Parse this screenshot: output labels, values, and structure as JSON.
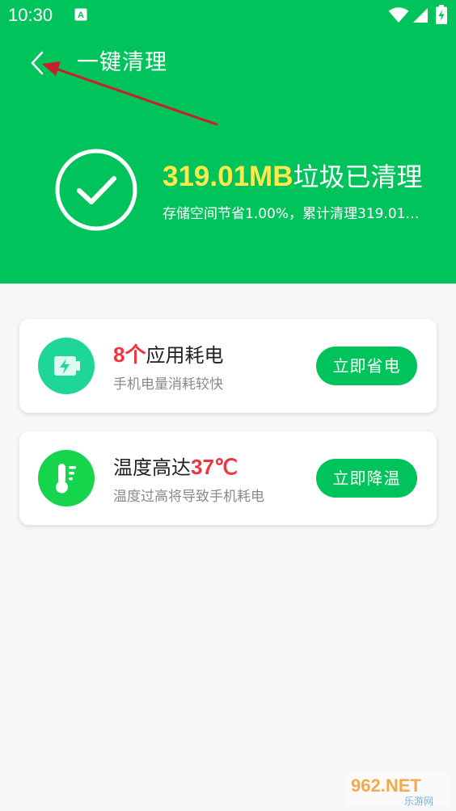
{
  "status_bar": {
    "time": "10:30",
    "notification_icon": "a-notification-icon",
    "wifi_icon": "wifi-icon",
    "signal_icon": "signal-icon",
    "battery_icon": "battery-charging-icon"
  },
  "header": {
    "title": "一键清理",
    "back_icon": "chevron-left-icon",
    "background_color": "#00c45b"
  },
  "clean_result": {
    "amount": "319.01MB",
    "status": "垃圾已清理",
    "subtitle": "存储空间节省1.00%，累计清理319.01…",
    "amount_color": "#ffe84a"
  },
  "cards": [
    {
      "icon": "battery-bolt-icon",
      "highlight": "8个",
      "title": "应用耗电",
      "description": "手机电量消耗较快",
      "button_label": "立即省电"
    },
    {
      "icon": "thermometer-icon",
      "title": "温度高达",
      "highlight": "37℃",
      "description": "温度过高将导致手机耗电",
      "button_label": "立即降温"
    }
  ],
  "colors": {
    "accent": "#00c45b",
    "highlight_red": "#f0333f",
    "annotation_arrow": "#c8202a"
  },
  "watermark": {
    "text": "962.NET",
    "subtext": "乐游网"
  }
}
